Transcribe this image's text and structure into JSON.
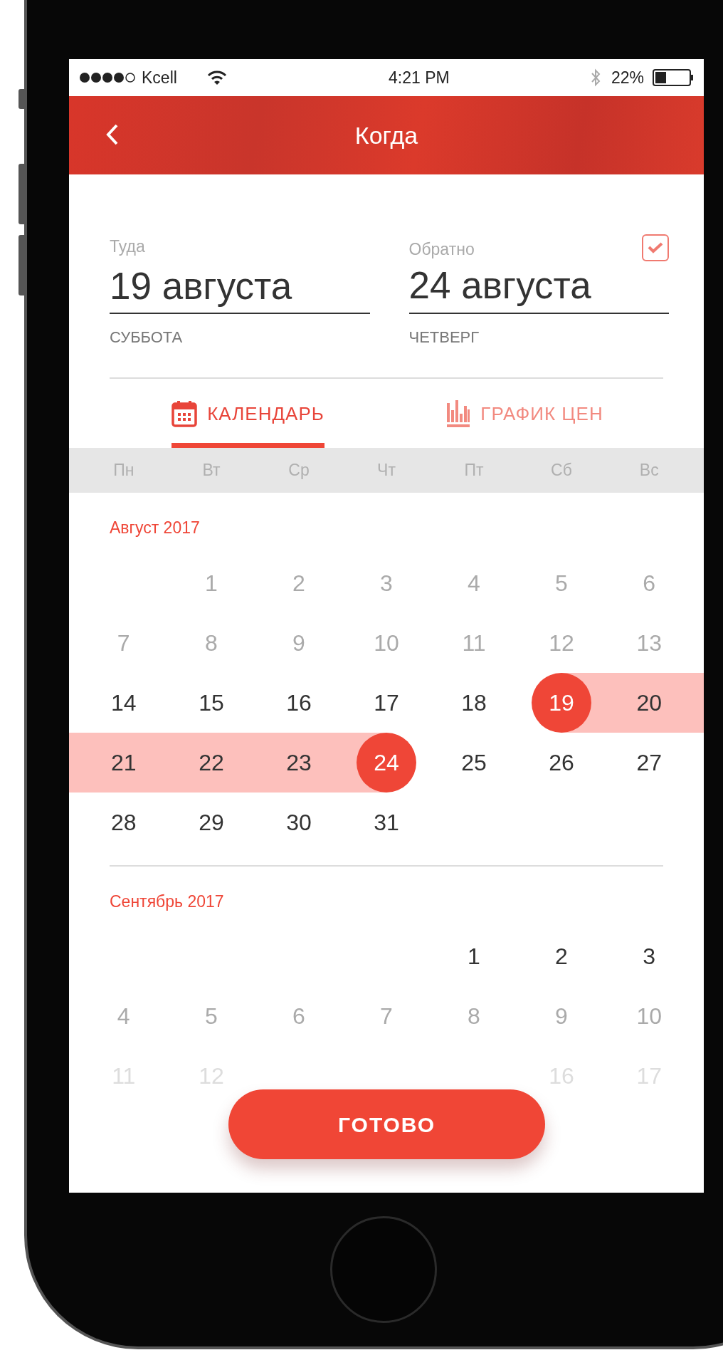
{
  "status_bar": {
    "carrier": "Kcell",
    "time": "4:21 PM",
    "battery": "22%"
  },
  "header": {
    "title": "Когда"
  },
  "dates": [
    {
      "label": "Туда",
      "value": "19 августа",
      "weekday": "СУББОТА"
    },
    {
      "label": "Обратно",
      "value": "24 августа",
      "weekday": "ЧЕТВЕРГ",
      "checkbox": {
        "checked": true
      }
    }
  ],
  "tabs": [
    {
      "kind": "calendar",
      "label": "КАЛЕНДАРЬ",
      "selected": true
    },
    {
      "kind": "chart",
      "label": "ГРАФИК ЦЕН",
      "selected": false
    }
  ],
  "weekdays": [
    "Пн",
    "Вт",
    "Ср",
    "Чт",
    "Пт",
    "Сб",
    "Вс"
  ],
  "months": [
    {
      "title": "Август 2017",
      "weeks": [
        [
          {
            "kind": "blank"
          },
          {
            "kind": "past",
            "day": "1",
            "selected": false,
            "in_range": false
          },
          {
            "kind": "past",
            "day": "2",
            "selected": false,
            "in_range": false
          },
          {
            "kind": "past",
            "day": "3",
            "selected": false,
            "in_range": false
          },
          {
            "kind": "past",
            "day": "4",
            "selected": false,
            "in_range": false
          },
          {
            "kind": "past",
            "day": "5",
            "selected": false,
            "in_range": false
          },
          {
            "kind": "past",
            "day": "6",
            "selected": false,
            "in_range": false
          }
        ],
        [
          {
            "kind": "past",
            "day": "7",
            "selected": false,
            "in_range": false
          },
          {
            "kind": "past",
            "day": "8",
            "selected": false,
            "in_range": false
          },
          {
            "kind": "past",
            "day": "9",
            "selected": false,
            "in_range": false
          },
          {
            "kind": "past",
            "day": "10",
            "selected": false,
            "in_range": false
          },
          {
            "kind": "past",
            "day": "11",
            "selected": false,
            "in_range": false
          },
          {
            "kind": "past",
            "day": "12",
            "selected": false,
            "in_range": false
          },
          {
            "kind": "past",
            "day": "13",
            "selected": false,
            "in_range": false
          }
        ],
        [
          {
            "kind": "day",
            "day": "14",
            "selected": false,
            "in_range": false
          },
          {
            "kind": "day",
            "day": "15",
            "selected": false,
            "in_range": false
          },
          {
            "kind": "day",
            "day": "16",
            "selected": false,
            "in_range": false
          },
          {
            "kind": "day",
            "day": "17",
            "selected": false,
            "in_range": false
          },
          {
            "kind": "day",
            "day": "18",
            "selected": false,
            "in_range": false
          },
          {
            "kind": "day",
            "day": "19",
            "selected": true,
            "in_range": false
          },
          {
            "kind": "day",
            "day": "20",
            "selected": false,
            "in_range": true
          }
        ],
        [
          {
            "kind": "day",
            "day": "21",
            "selected": false,
            "in_range": true
          },
          {
            "kind": "day",
            "day": "22",
            "selected": false,
            "in_range": true
          },
          {
            "kind": "day",
            "day": "23",
            "selected": false,
            "in_range": true
          },
          {
            "kind": "day",
            "day": "24",
            "selected": true,
            "in_range": false
          },
          {
            "kind": "day",
            "day": "25",
            "selected": false,
            "in_range": false
          },
          {
            "kind": "day",
            "day": "26",
            "selected": false,
            "in_range": false
          },
          {
            "kind": "day",
            "day": "27",
            "selected": false,
            "in_range": false
          }
        ],
        [
          {
            "kind": "day",
            "day": "28",
            "selected": false,
            "in_range": false
          },
          {
            "kind": "day",
            "day": "29",
            "selected": false,
            "in_range": false
          },
          {
            "kind": "day",
            "day": "30",
            "selected": false,
            "in_range": false
          },
          {
            "kind": "day",
            "day": "31",
            "selected": false,
            "in_range": false
          },
          {
            "kind": "blank"
          },
          {
            "kind": "blank"
          },
          {
            "kind": "blank"
          }
        ]
      ]
    },
    {
      "title": "Сентябрь 2017",
      "weeks": [
        [
          {
            "kind": "blank"
          },
          {
            "kind": "blank"
          },
          {
            "kind": "blank"
          },
          {
            "kind": "blank"
          },
          {
            "kind": "day",
            "day": "1",
            "selected": false,
            "in_range": false
          },
          {
            "kind": "day",
            "day": "2",
            "selected": false,
            "in_range": false
          },
          {
            "kind": "day",
            "day": "3",
            "selected": false,
            "in_range": false
          }
        ],
        [
          {
            "kind": "past",
            "day": "4",
            "selected": false,
            "in_range": false
          },
          {
            "kind": "past",
            "day": "5",
            "selected": false,
            "in_range": false
          },
          {
            "kind": "past",
            "day": "6",
            "selected": false,
            "in_range": false
          },
          {
            "kind": "past",
            "day": "7",
            "selected": false,
            "in_range": false
          },
          {
            "kind": "past",
            "day": "8",
            "selected": false,
            "in_range": false
          },
          {
            "kind": "past",
            "day": "9",
            "selected": false,
            "in_range": false
          },
          {
            "kind": "past",
            "day": "10",
            "selected": false,
            "in_range": false
          }
        ],
        [
          {
            "kind": "faded",
            "day": "11",
            "selected": false,
            "in_range": false
          },
          {
            "kind": "faded",
            "day": "12",
            "selected": false,
            "in_range": false
          },
          {
            "kind": "blank"
          },
          {
            "kind": "blank"
          },
          {
            "kind": "blank"
          },
          {
            "kind": "faded",
            "day": "16",
            "selected": false,
            "in_range": false
          },
          {
            "kind": "faded",
            "day": "17",
            "selected": false,
            "in_range": false
          }
        ]
      ]
    }
  ],
  "done_button": "ГОТОВО"
}
